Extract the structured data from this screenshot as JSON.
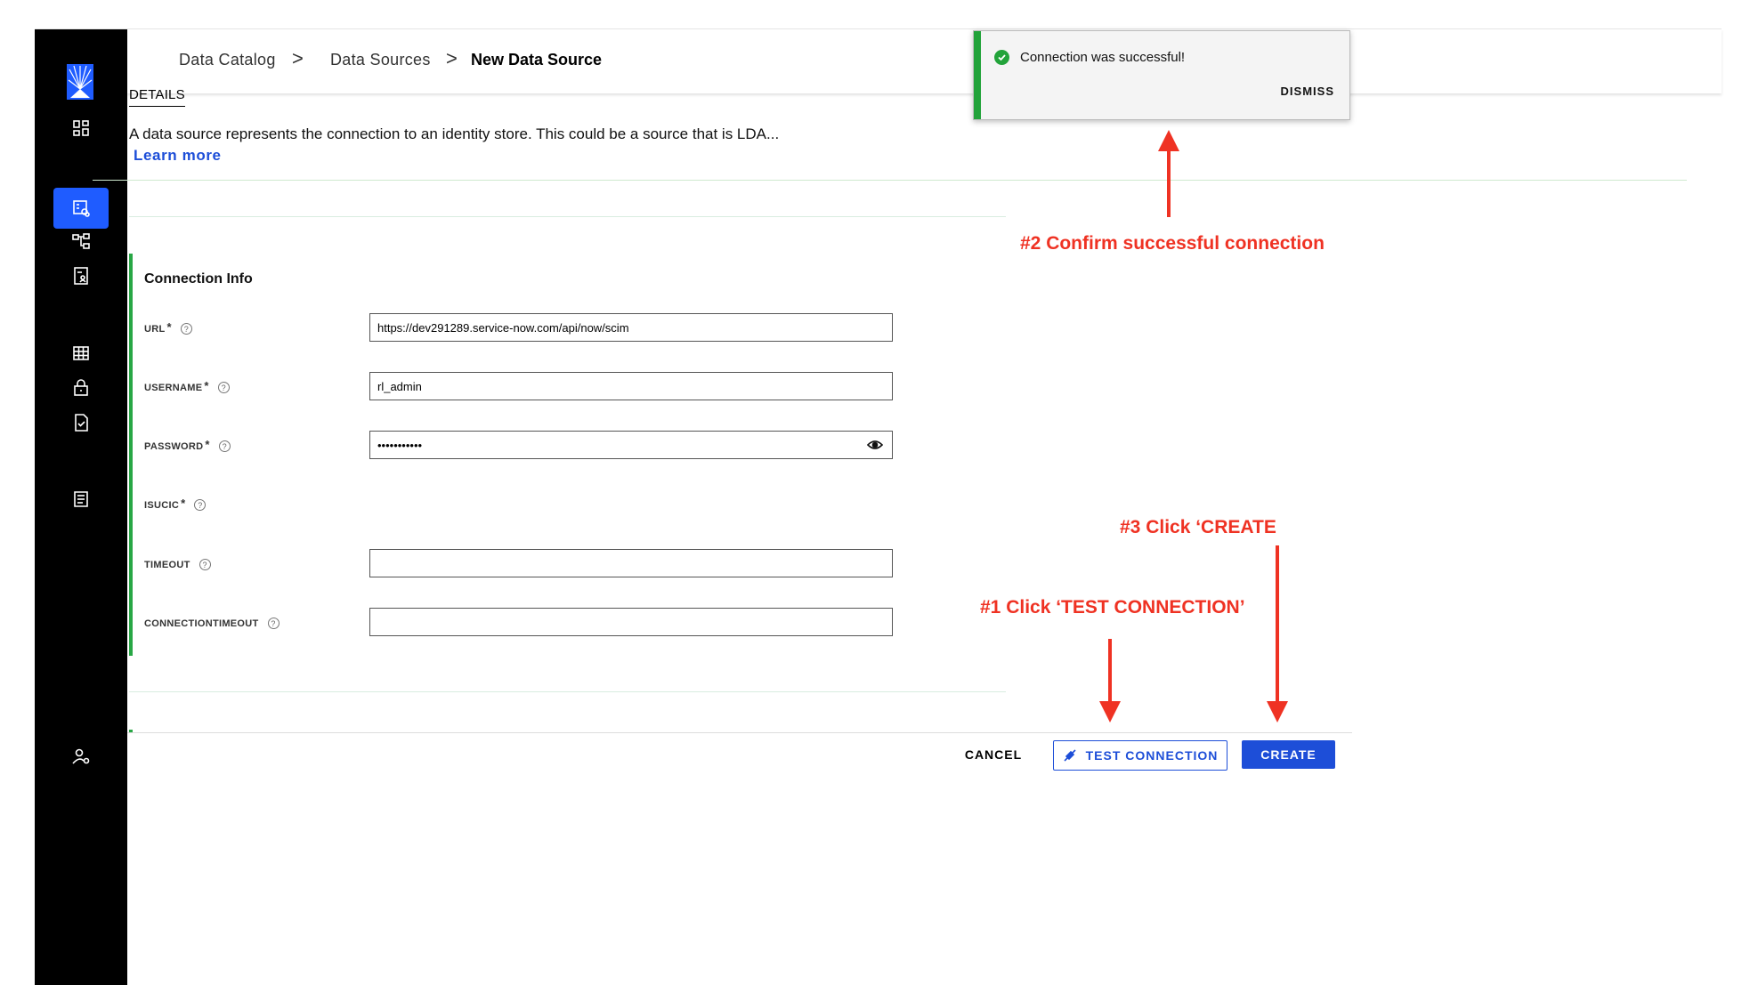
{
  "breadcrumb": {
    "items": [
      "Data Catalog",
      "Data Sources"
    ],
    "current": "New Data Source",
    "separator": ">"
  },
  "details": {
    "tab_label": "DETAILS",
    "description": "A data source represents the connection to an identity store. This could be a source that is LDA...",
    "learn_more": "Learn more"
  },
  "connection_info": {
    "title": "Connection Info",
    "required_marker": "*",
    "help_glyph": "?",
    "fields": {
      "url": {
        "label": "URL",
        "value": "https://dev291289.service-now.com/api/now/scim"
      },
      "username": {
        "label": "USERNAME",
        "value": "rl_admin"
      },
      "password": {
        "label": "PASSWORD",
        "value": "•••••••••••"
      },
      "isucic": {
        "label": "ISUCIC"
      },
      "timeout": {
        "label": "TIMEOUT",
        "value": ""
      },
      "connectiontimeout": {
        "label": "CONNECTIONTIMEOUT",
        "value": ""
      }
    }
  },
  "footer": {
    "cancel": "CANCEL",
    "test_connection": "TEST CONNECTION",
    "create": "CREATE"
  },
  "toast": {
    "message": "Connection was successful!",
    "dismiss": "DISMISS",
    "icon": "check-circle-icon"
  },
  "annotations": {
    "step2": "#2 Confirm successful connection",
    "step3": "#3 Click ‘CREATE",
    "step1": "#1 Click ‘TEST CONNECTION’"
  },
  "colors": {
    "sidebar": "#000000",
    "accent": "#1d4ed8",
    "active_nav": "#1f5cff",
    "success": "#22a33a",
    "section_bar": "#28a745",
    "annotation": "#ef3223"
  },
  "sidebar_icons": [
    "dashboard-icon",
    "data-catalog-icon",
    "hierarchy-icon",
    "identity-icon",
    "table-icon",
    "lock-icon",
    "certification-icon",
    "report-icon",
    "user-settings-icon"
  ]
}
